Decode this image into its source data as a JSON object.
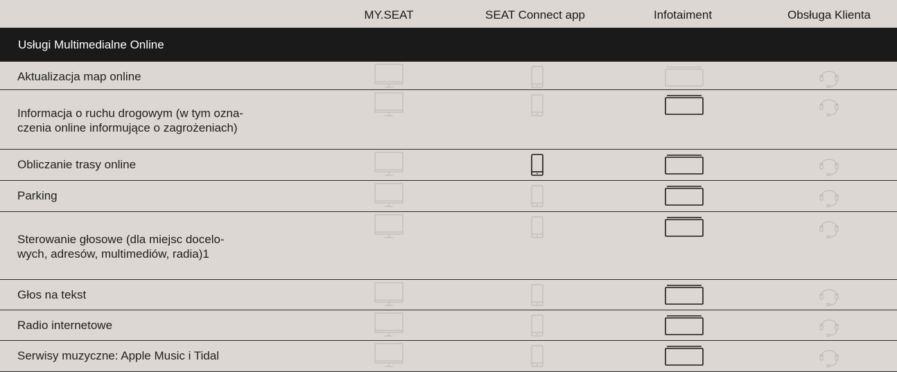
{
  "columns": [
    "MY.SEAT",
    "SEAT Connect app",
    "Infotaiment",
    "Obsługa Klienta"
  ],
  "section_title": "Usługi Multimedialne Online",
  "rows": [
    {
      "label_lines": [
        "Aktualizacja map online"
      ],
      "active": [
        false,
        false,
        false,
        false
      ]
    },
    {
      "label_lines": [
        "Informacja o ruchu drogowym (w tym ozna-",
        "czenia online informujące o zagrożeniach)"
      ],
      "active": [
        false,
        false,
        true,
        false
      ]
    },
    {
      "label_lines": [
        "Obliczanie trasy online"
      ],
      "active": [
        false,
        true,
        true,
        false
      ]
    },
    {
      "label_lines": [
        "Parking"
      ],
      "active": [
        false,
        false,
        true,
        false
      ]
    },
    {
      "label_lines": [
        "Sterowanie głosowe (dla miejsc docelo-",
        "wych, adresów, multimediów, radia)1"
      ],
      "active": [
        false,
        false,
        true,
        false
      ]
    },
    {
      "label_lines": [
        "Głos na tekst"
      ],
      "active": [
        false,
        false,
        true,
        false
      ]
    },
    {
      "label_lines": [
        "Radio internetowe"
      ],
      "active": [
        false,
        false,
        true,
        false
      ]
    },
    {
      "label_lines": [
        "Serwisy muzyczne: Apple Music i Tidal"
      ],
      "active": [
        false,
        false,
        true,
        false
      ]
    }
  ],
  "icons": [
    "monitor-icon",
    "phone-icon",
    "infotainment-screen-icon",
    "headset-icon"
  ],
  "colors": {
    "background": "#dcd7d2",
    "section_bar": "#1a1a1a",
    "active_icon": "#1a1a1a",
    "inactive_icon": "#b9b4ae"
  }
}
